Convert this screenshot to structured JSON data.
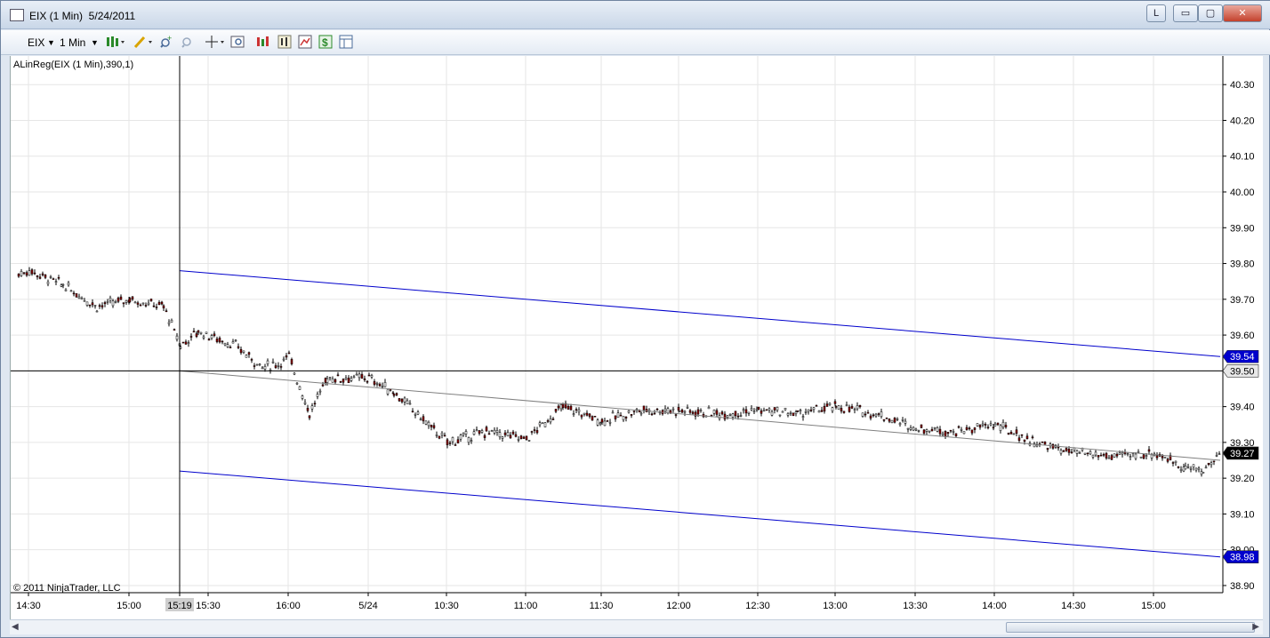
{
  "window": {
    "title": "EIX (1 Min)  5/24/2011",
    "link_button": "L",
    "min_glyph": "▭",
    "max_glyph": "▢",
    "close_glyph": "✕"
  },
  "toolbar": {
    "instrument": "EIX",
    "interval": "1 Min",
    "icons": [
      "chart-style-icon",
      "draw-tool-icon",
      "zoom-in-icon",
      "zoom-out-icon",
      "crosshair-icon",
      "properties-icon",
      "indicators-icon",
      "strategies-icon",
      "chart-trader-icon",
      "dollar-icon",
      "data-box-icon"
    ]
  },
  "chart": {
    "indicator_label": "ALinReg(EIX (1 Min),390,1)",
    "copyright": "© 2011 NinjaTrader, LLC",
    "crosshair_time_label": "15:19",
    "crosshair_price_label": "39.50",
    "last_price_label": "39.27",
    "upper_band_label": "39.54",
    "lower_band_label": "38.98",
    "colors": {
      "band": "#0000cc",
      "regression": "#808080",
      "up_bar": "#000000",
      "down_bar": "#8b0000",
      "grid": "#e6e6e6"
    }
  },
  "chart_data": {
    "type": "line",
    "title": "",
    "instrument": "EIX",
    "interval": "1 Min",
    "date": "5/24/2011",
    "ylim": [
      38.88,
      40.38
    ],
    "y_ticks": [
      "40.30",
      "40.20",
      "40.10",
      "40.00",
      "39.90",
      "39.80",
      "39.70",
      "39.60",
      "39.50",
      "39.40",
      "39.30",
      "39.20",
      "39.10",
      "39.00",
      "38.90"
    ],
    "x_ticks": [
      "14:30",
      "15:00",
      "15:19",
      "15:30",
      "16:00",
      "5/24",
      "10:30",
      "11:00",
      "11:30",
      "12:00",
      "12:30",
      "13:00",
      "13:30",
      "14:00",
      "14:30",
      "15:00"
    ],
    "series": [
      {
        "name": "ALinReg(EIX (1 Min),390,1)",
        "x": [
          "15:19",
          "15:55"
        ],
        "values": [
          39.5,
          39.25
        ]
      },
      {
        "x": [
          "15:19",
          "15:55"
        ],
        "values": [
          39.78,
          39.54
        ]
      },
      {
        "x": [
          "15:19",
          "15:55"
        ],
        "values": [
          39.22,
          38.98
        ]
      }
    ],
    "price_path": {
      "x": [
        "14:23",
        "14:30",
        "14:40",
        "14:50",
        "15:00",
        "15:10",
        "15:19",
        "15:25",
        "15:35",
        "15:45",
        "15:55",
        "16:00",
        "16:05",
        "16:10",
        "5/24",
        "10:10",
        "10:20",
        "10:30",
        "10:45",
        "11:00",
        "11:15",
        "11:30",
        "11:45",
        "12:00",
        "12:15",
        "12:30",
        "12:45",
        "13:00",
        "13:15",
        "13:30",
        "13:45",
        "14:00",
        "14:15",
        "14:30",
        "14:45",
        "15:00",
        "15:10",
        "15:15",
        "15:20"
      ],
      "values": [
        39.77,
        39.78,
        39.74,
        39.68,
        39.7,
        39.68,
        39.57,
        39.61,
        39.57,
        39.51,
        39.52,
        39.54,
        39.38,
        39.48,
        39.48,
        39.44,
        39.37,
        39.3,
        39.33,
        39.31,
        39.4,
        39.36,
        39.39,
        39.39,
        39.38,
        39.39,
        39.38,
        39.4,
        39.38,
        39.34,
        39.33,
        39.35,
        39.3,
        39.27,
        39.26,
        39.27,
        39.23,
        39.22,
        39.27
      ]
    }
  },
  "scrollbar": {
    "left_arrow": "◀",
    "right_arrow": "▶"
  }
}
